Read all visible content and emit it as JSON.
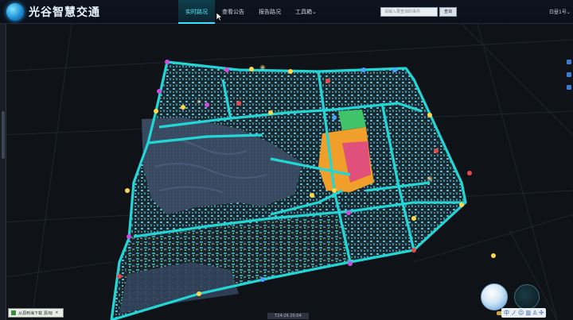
{
  "app": {
    "title": "光谷智慧交通"
  },
  "nav": [
    {
      "label": "实时路况",
      "active": true
    },
    {
      "label": "查看公告",
      "active": false
    },
    {
      "label": "报告路况",
      "active": false
    },
    {
      "label": "工具箱",
      "active": false
    }
  ],
  "nav_dropdown_glyph": "⌄",
  "search": {
    "placeholder": "请输入要查询的事件",
    "button": "查询"
  },
  "weather": {
    "label": "白昼1号",
    "glyph": "⌄"
  },
  "bottom_panel": {
    "label": "从源到海下载 源/标",
    "close": "×"
  },
  "timebar": {
    "text": "T24-26 20:04"
  },
  "toolbar": {
    "items": [
      "中",
      "ノ",
      "☺",
      "▥",
      "♙",
      "✣"
    ]
  },
  "colors": {
    "accent": "#3de0ff",
    "road": "#23d6d6",
    "water": "#3b4f6a",
    "block": "#4fd0e0",
    "hotspot": "#f0a02a"
  }
}
